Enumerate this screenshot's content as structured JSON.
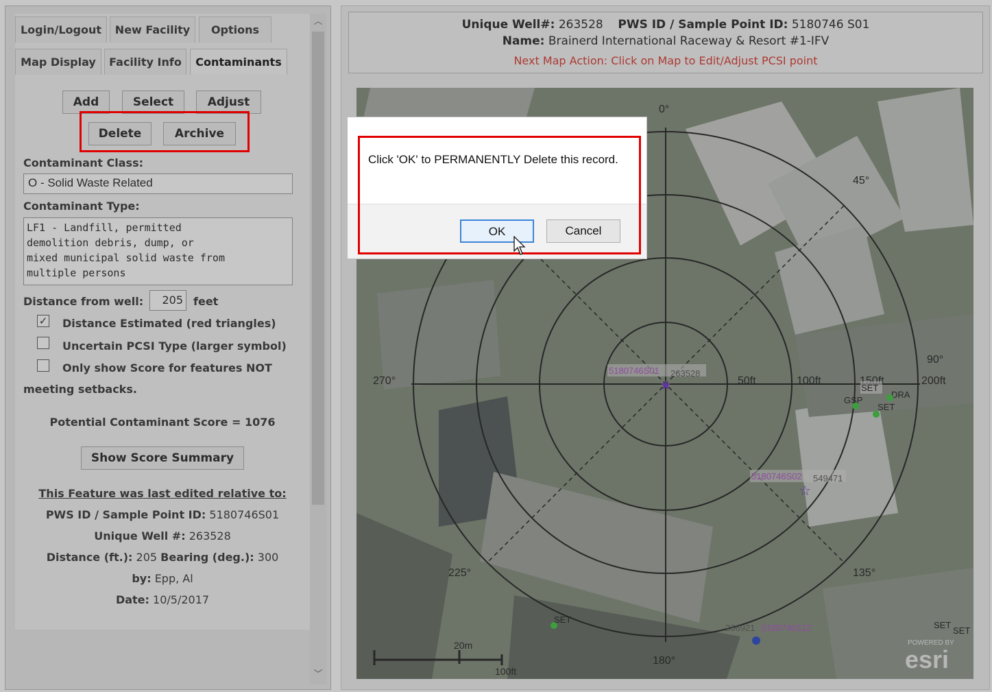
{
  "tabs": {
    "login": "Login/Logout",
    "new_facility": "New Facility",
    "options": "Options",
    "map_display": "Map Display",
    "facility_info": "Facility Info",
    "contaminants": "Contaminants"
  },
  "buttons": {
    "add": "Add",
    "select": "Select",
    "adjust": "Adjust",
    "delete": "Delete",
    "archive": "Archive"
  },
  "form": {
    "class_label": "Contaminant Class:",
    "class_value": "O - Solid Waste Related",
    "type_label": "Contaminant Type:",
    "type_value": "LF1 - Landfill, permitted\ndemolition debris, dump, or\nmixed municipal solid waste from\nmultiple persons",
    "distance_label": "Distance from well:",
    "distance_value": "205",
    "distance_unit": "feet",
    "check_estimated": "Distance Estimated (red triangles)",
    "check_estimated_checked": true,
    "check_uncertain": "Uncertain PCSI Type (larger symbol)",
    "check_uncertain_checked": false,
    "check_only_score_1": "Only show Score for features NOT",
    "check_only_score_2": "meeting setbacks.",
    "check_only_score_checked": false
  },
  "score_text": "Potential Contaminant Score = 1076",
  "show_summary": "Show Score Summary",
  "last_edited": {
    "title": "This Feature was last edited relative to:",
    "pws_label": "PWS ID / Sample Point ID:",
    "pws_value": "5180746S01",
    "well_label": "Unique Well #:",
    "well_value": "263528",
    "dist_label": "Distance (ft.):",
    "dist_value": "205",
    "bearing_label": "Bearing (deg.):",
    "bearing_value": "300",
    "by_label": "by:",
    "by_value": "Epp, Al",
    "date_label": "Date:",
    "date_value": "10/5/2017"
  },
  "header": {
    "well_label": "Unique Well#:",
    "well_value": "263528",
    "pws_label": "PWS ID / Sample Point ID:",
    "pws_value": "5180746 S01",
    "name_label": "Name:",
    "name_value": "Brainerd International Raceway & Resort #1-IFV",
    "action": "Next Map Action: Click on Map to Edit/Adjust PCSI point"
  },
  "map": {
    "degrees": {
      "n": "0°",
      "ne": "45°",
      "e": "90°",
      "se": "135°",
      "s": "180°",
      "sw": "225°",
      "w": "270°"
    },
    "rings": {
      "r50": "50ft",
      "r100": "100ft",
      "r150": "150ft",
      "r200": "200ft"
    },
    "points": {
      "center_id": "5180746S01",
      "center_well": "263528",
      "s02_id": "5180746S02",
      "s02_well": "549471",
      "s12_well": "266921",
      "s12_id": "5180746S12",
      "set": "SET",
      "dra": "DRA",
      "gsp": "GSP"
    },
    "scale": {
      "big": "20m",
      "small": "100ft"
    },
    "esri_small": "POWERED BY",
    "esri_big": "esri"
  },
  "dialog": {
    "message": "Click 'OK' to PERMANENTLY Delete this record.",
    "ok": "OK",
    "cancel": "Cancel"
  },
  "colors": {
    "highlight": "#e00000",
    "action_text": "#d9342b",
    "ok_border": "#3c84d8",
    "map_bg": "#7f8a78"
  }
}
